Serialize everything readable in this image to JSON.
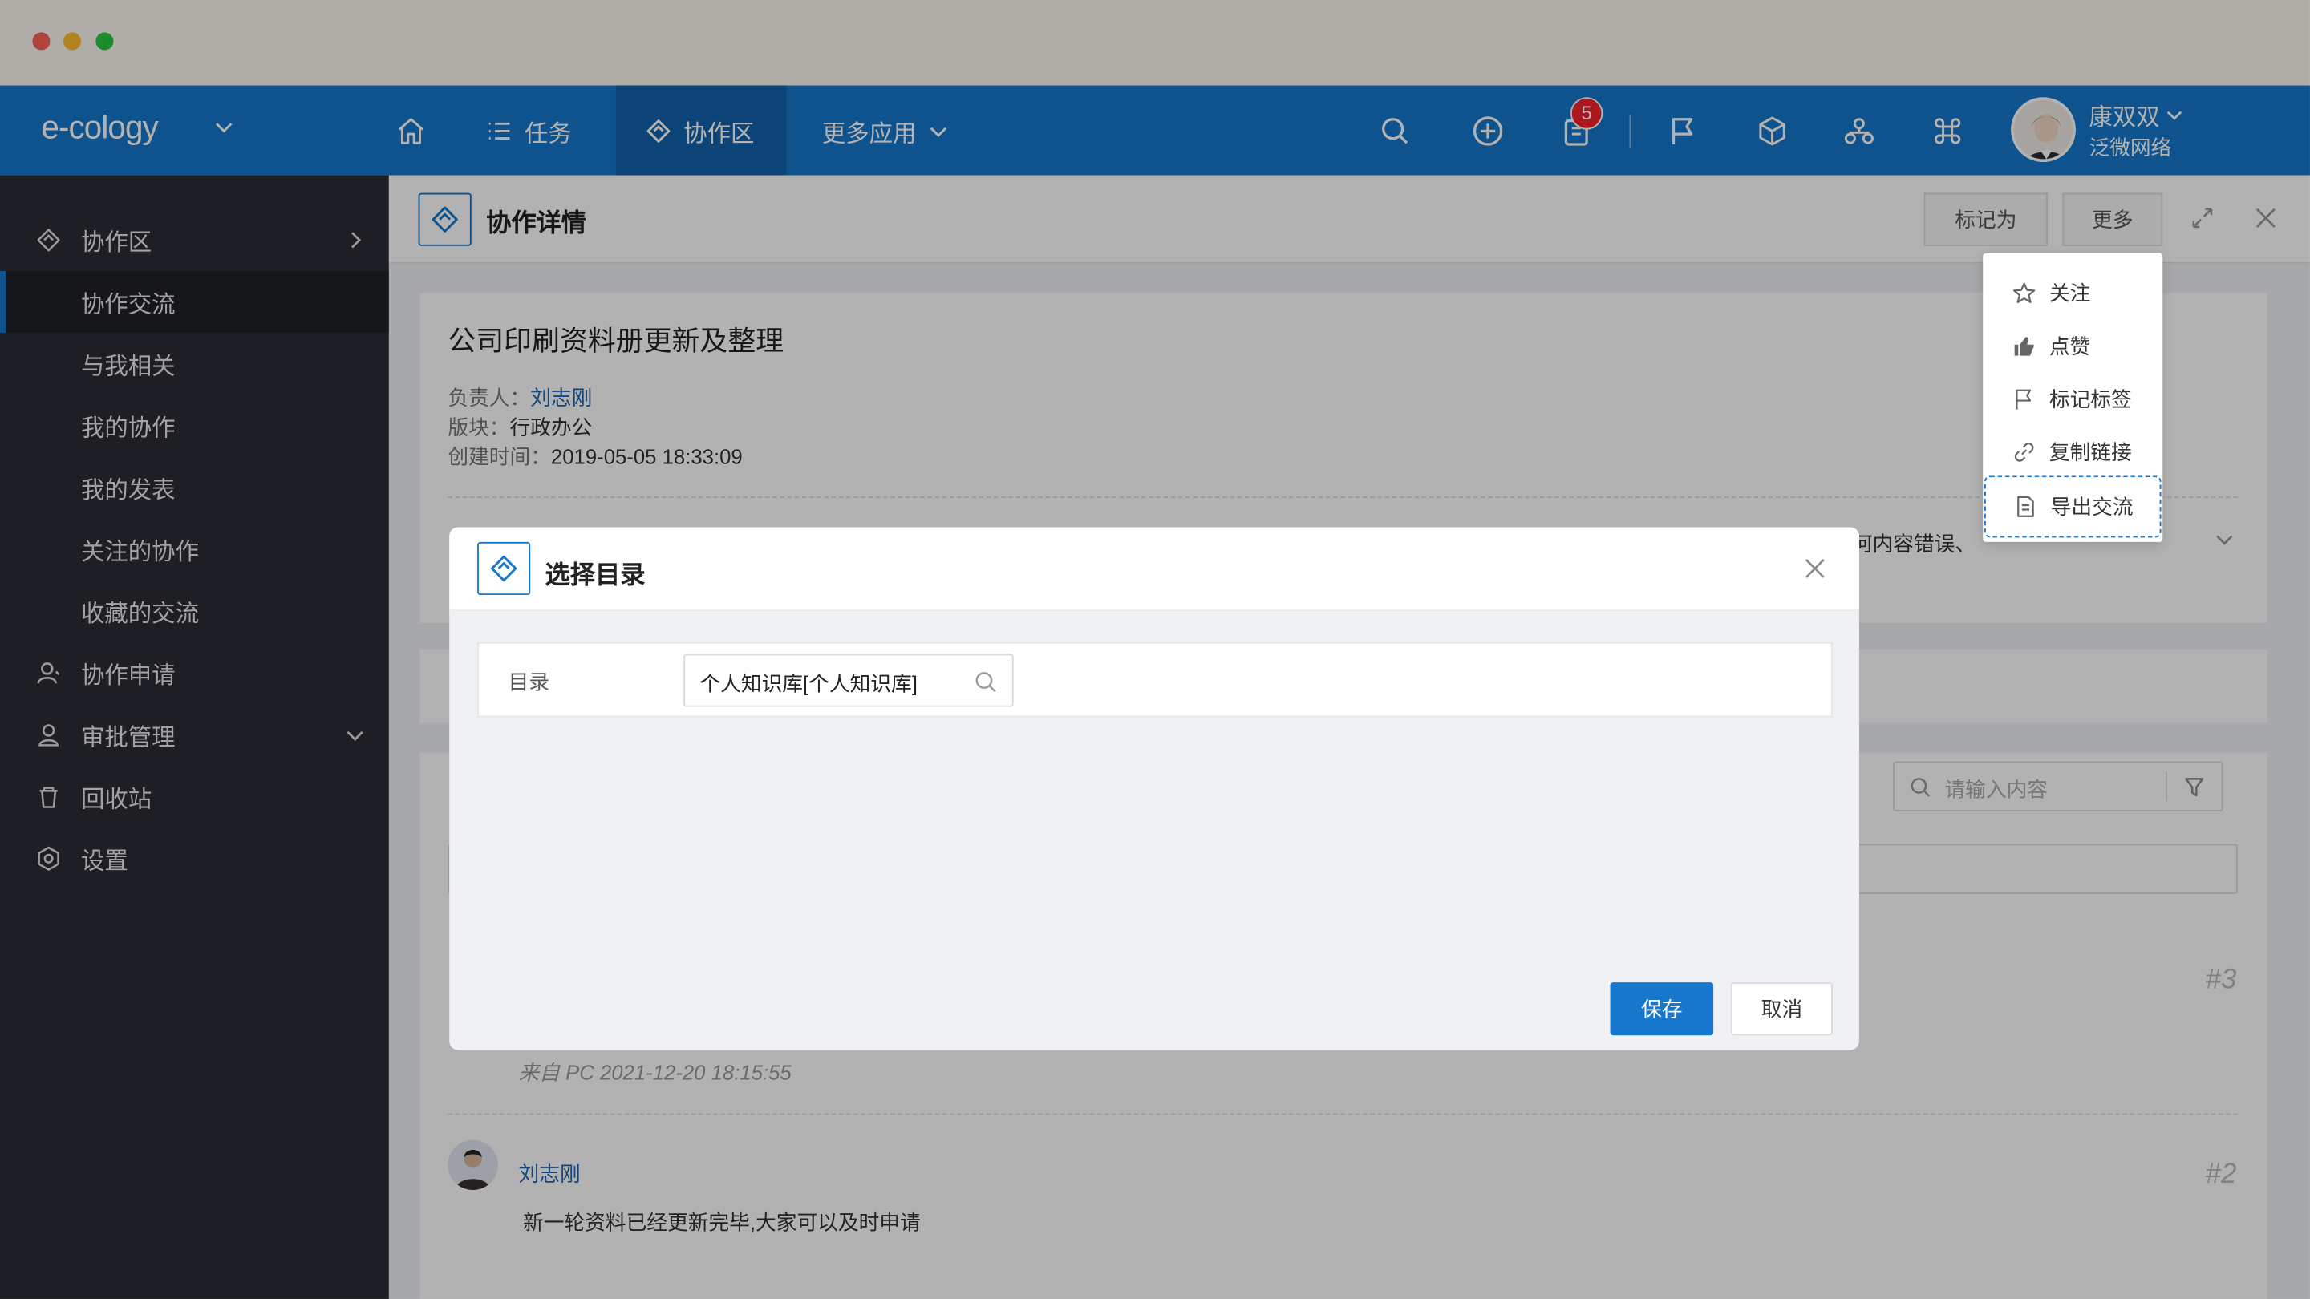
{
  "window": {
    "traffic_lights": [
      "close",
      "minimize",
      "zoom"
    ]
  },
  "topnav": {
    "brand": "e-cology",
    "items": [
      {
        "label": ""
      },
      {
        "label": "任务"
      },
      {
        "label": "协作区"
      },
      {
        "label": "更多应用"
      }
    ],
    "notification_count": "5",
    "user": {
      "name": "康双双",
      "org": "泛微网络"
    }
  },
  "sidebar": {
    "items": [
      {
        "label": "协作区"
      },
      {
        "label": "协作交流"
      },
      {
        "label": "与我相关"
      },
      {
        "label": "我的协作"
      },
      {
        "label": "我的发表"
      },
      {
        "label": "关注的协作"
      },
      {
        "label": "收藏的交流"
      },
      {
        "label": "协作申请"
      },
      {
        "label": "审批管理"
      },
      {
        "label": "回收站"
      },
      {
        "label": "设置"
      }
    ]
  },
  "main": {
    "header_title": "协作详情",
    "mark_as": "标记为",
    "more": "更多",
    "detail": {
      "title": "公司印刷资料册更新及整理",
      "owner_key": "负责人：",
      "owner": "刘志刚",
      "block_key": "版块：",
      "block": "行政办公",
      "created_key": "创建时间：",
      "created": "2019-05-05 18:33:09",
      "partial_text": "何内容错误、"
    },
    "search_placeholder": "请输入内容",
    "posts": [
      {
        "number": "#3",
        "from": "来自 PC 2021-12-20 18:15:55"
      },
      {
        "number": "#2",
        "author": "刘志刚",
        "content": "新一轮资料已经更新完毕,大家可以及时申请"
      }
    ]
  },
  "dropdown": {
    "items": [
      {
        "label": "关注"
      },
      {
        "label": "点赞"
      },
      {
        "label": "标记标签"
      },
      {
        "label": "复制链接"
      },
      {
        "label": "导出交流"
      }
    ]
  },
  "dialog": {
    "title": "选择目录",
    "field_label": "目录",
    "field_value": "个人知识库[个人知识库]",
    "save": "保存",
    "cancel": "取消"
  },
  "colors": {
    "primary": "#1677cc",
    "sidebar": "#2a2d34",
    "badge": "#f5222d"
  }
}
